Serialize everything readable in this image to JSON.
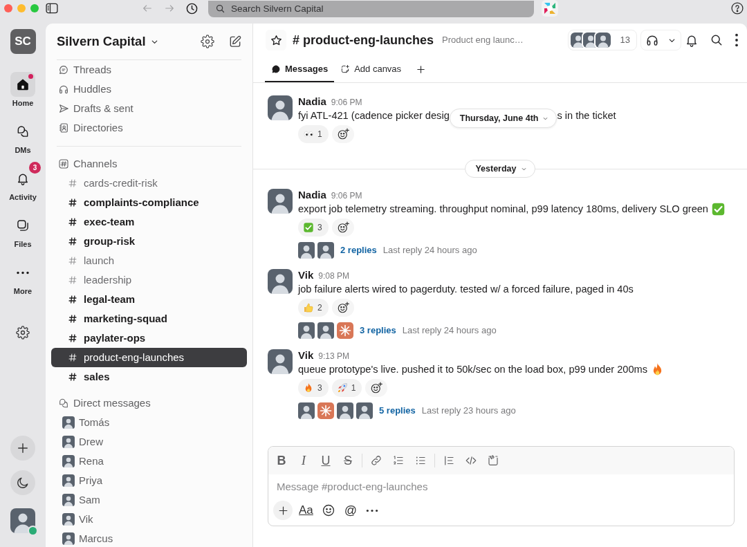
{
  "titlebar": {
    "search_placeholder": "Search Silvern Capital"
  },
  "rail": {
    "workspace_initials": "SC",
    "items": [
      {
        "kind": "home",
        "label": "Home",
        "selected": true,
        "unread_dot": true
      },
      {
        "kind": "dms",
        "label": "DMs",
        "selected": false,
        "unread_dot": false
      },
      {
        "kind": "activity",
        "label": "Activity",
        "selected": false,
        "unread_dot": false,
        "badge": "3"
      },
      {
        "kind": "files",
        "label": "Files",
        "selected": false,
        "unread_dot": false
      },
      {
        "kind": "more",
        "label": "More",
        "selected": false,
        "unread_dot": false
      }
    ]
  },
  "sidebar": {
    "workspace_name": "Silvern Capital",
    "nav": [
      {
        "kind": "threads",
        "label": "Threads"
      },
      {
        "kind": "huddles",
        "label": "Huddles"
      },
      {
        "kind": "drafts",
        "label": "Drafts & sent"
      },
      {
        "kind": "directories",
        "label": "Directories"
      }
    ],
    "channels_header": "Channels",
    "channels": [
      {
        "name": "cards-credit-risk",
        "unread": false,
        "selected": false
      },
      {
        "name": "complaints-compliance",
        "unread": true,
        "selected": false
      },
      {
        "name": "exec-team",
        "unread": true,
        "selected": false
      },
      {
        "name": "group-risk",
        "unread": true,
        "selected": false
      },
      {
        "name": "launch",
        "unread": false,
        "selected": false
      },
      {
        "name": "leadership",
        "unread": false,
        "selected": false
      },
      {
        "name": "legal-team",
        "unread": true,
        "selected": false
      },
      {
        "name": "marketing-squad",
        "unread": true,
        "selected": false
      },
      {
        "name": "paylater-ops",
        "unread": true,
        "selected": false
      },
      {
        "name": "product-eng-launches",
        "unread": false,
        "selected": true
      },
      {
        "name": "sales",
        "unread": true,
        "selected": false
      }
    ],
    "dms_header": "Direct messages",
    "dms": [
      {
        "name": "Tomás"
      },
      {
        "name": "Drew"
      },
      {
        "name": "Rena"
      },
      {
        "name": "Priya"
      },
      {
        "name": "Sam"
      },
      {
        "name": "Vik"
      },
      {
        "name": "Marcus"
      }
    ]
  },
  "channel_header": {
    "title": "# product-eng-launches",
    "topic": "Product eng launc…",
    "member_count": "13",
    "tabs": [
      {
        "kind": "messages",
        "label": "Messages",
        "selected": true
      },
      {
        "kind": "canvas",
        "label": "Add canvas",
        "selected": false
      }
    ]
  },
  "sticky_date": "Thursday, June 4th",
  "timeline": [
    {
      "kind": "message",
      "author": "Nadia",
      "time": "9:06 PM",
      "text_parts": [
        "fyi ATL-421 (cadence picker desig",
        "s in the ticket"
      ],
      "reactions": [
        {
          "kind": "eyes",
          "count": "1"
        }
      ]
    },
    {
      "kind": "divider",
      "label": "Yesterday"
    },
    {
      "kind": "message",
      "author": "Nadia",
      "time": "9:06 PM",
      "text_parts": [
        "export job telemetry streaming. throughput nominal, p99 latency 180ms, delivery SLO green"
      ],
      "trailing_emoji": {
        "kind": "check"
      },
      "reactions": [
        {
          "kind": "check",
          "count": "3"
        }
      ],
      "thread": {
        "participants": [
          {
            "kind": "person"
          },
          {
            "kind": "person"
          }
        ],
        "replies": "2 replies",
        "last_reply": "Last reply 24 hours ago"
      }
    },
    {
      "kind": "message",
      "author": "Vik",
      "time": "9:08 PM",
      "text_parts": [
        "job failure alerts wired to pagerduty. tested w/ a forced failure, paged in 40s"
      ],
      "reactions": [
        {
          "kind": "thumbs_up",
          "count": "2"
        }
      ],
      "thread": {
        "participants": [
          {
            "kind": "person"
          },
          {
            "kind": "person"
          },
          {
            "kind": "sparkle"
          }
        ],
        "replies": "3 replies",
        "last_reply": "Last reply 24 hours ago"
      }
    },
    {
      "kind": "message",
      "author": "Vik",
      "time": "9:13 PM",
      "text_parts": [
        "queue prototype's live. pushed it to 50k/sec on the load box, p99 under 200ms"
      ],
      "trailing_emoji": {
        "kind": "fire"
      },
      "reactions": [
        {
          "kind": "fire",
          "count": "3"
        },
        {
          "kind": "rocket",
          "count": "1"
        }
      ],
      "thread": {
        "participants": [
          {
            "kind": "person"
          },
          {
            "kind": "sparkle"
          },
          {
            "kind": "person"
          },
          {
            "kind": "person"
          }
        ],
        "replies": "5 replies",
        "last_reply": "Last reply 23 hours ago"
      }
    }
  ],
  "composer": {
    "toolbar_groups": [
      [
        {
          "kind": "bold",
          "label": "B"
        },
        {
          "kind": "italic",
          "label": "I"
        },
        {
          "kind": "underline",
          "label": "U"
        },
        {
          "kind": "strike",
          "label": "S"
        }
      ],
      [
        {
          "kind": "link"
        },
        {
          "kind": "ordered_list"
        },
        {
          "kind": "bullet_list"
        }
      ],
      [
        {
          "kind": "quote"
        },
        {
          "kind": "code"
        },
        {
          "kind": "code_block"
        }
      ]
    ],
    "placeholder": "Message #product-eng-launches",
    "actions": [
      {
        "kind": "attach"
      },
      {
        "kind": "format",
        "label": "Aa"
      },
      {
        "kind": "emoji"
      },
      {
        "kind": "mention",
        "label": "@"
      },
      {
        "kind": "more"
      }
    ]
  }
}
